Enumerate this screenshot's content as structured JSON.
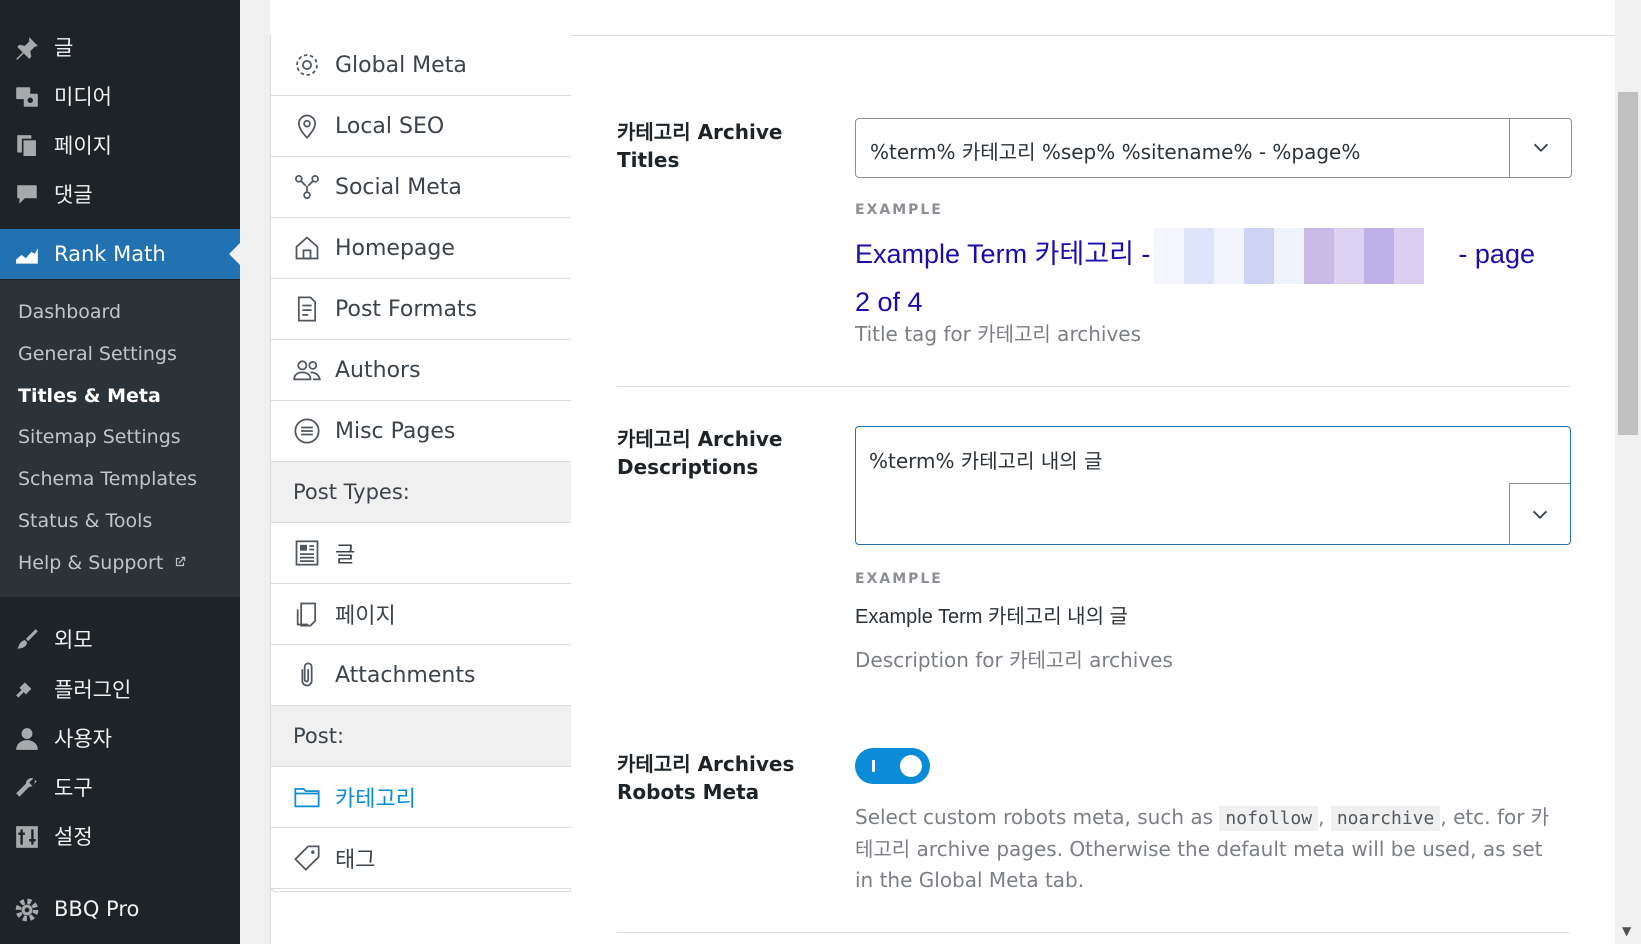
{
  "admin_menu": {
    "items_top": [
      {
        "label": "글",
        "icon": "pin-icon"
      },
      {
        "label": "미디어",
        "icon": "media-icon"
      },
      {
        "label": "페이지",
        "icon": "pages-icon"
      },
      {
        "label": "댓글",
        "icon": "comments-icon"
      }
    ],
    "current": {
      "label": "Rank Math",
      "icon": "rank-math-icon"
    },
    "submenu": [
      {
        "label": "Dashboard"
      },
      {
        "label": "General Settings"
      },
      {
        "label": "Titles & Meta"
      },
      {
        "label": "Sitemap Settings"
      },
      {
        "label": "Schema Templates"
      },
      {
        "label": "Status & Tools"
      },
      {
        "label": "Help & Support"
      }
    ],
    "items_bottom": [
      {
        "label": "외모",
        "icon": "appearance-icon"
      },
      {
        "label": "플러그인",
        "icon": "plugins-icon"
      },
      {
        "label": "사용자",
        "icon": "users-icon"
      },
      {
        "label": "도구",
        "icon": "tools-icon"
      },
      {
        "label": "설정",
        "icon": "settings-icon"
      },
      {
        "label": "BBQ Pro",
        "icon": "gear-icon"
      }
    ]
  },
  "tabs": {
    "general": [
      {
        "label": "Global Meta",
        "icon": "gear-icon"
      },
      {
        "label": "Local SEO",
        "icon": "location-pin-icon"
      },
      {
        "label": "Social Meta",
        "icon": "share-nodes-icon"
      },
      {
        "label": "Homepage",
        "icon": "home-icon"
      },
      {
        "label": "Post Formats",
        "icon": "document-icon"
      },
      {
        "label": "Authors",
        "icon": "users-icon"
      },
      {
        "label": "Misc Pages",
        "icon": "list-circle-icon"
      }
    ],
    "post_types_heading": "Post Types:",
    "post_types": [
      {
        "label": "글",
        "icon": "article-icon"
      },
      {
        "label": "페이지",
        "icon": "page-icon"
      },
      {
        "label": "Attachments",
        "icon": "paperclip-icon"
      }
    ],
    "post_heading": "Post:",
    "post": [
      {
        "label": "카테고리",
        "icon": "folder-icon"
      },
      {
        "label": "태그",
        "icon": "tag-icon"
      }
    ]
  },
  "fields": {
    "archive_titles": {
      "label": "카테고리 Archive Titles",
      "value": "%term% 카테고리 %sep% %sitename% - %page%",
      "example_label": "EXAMPLE",
      "example_prefix": "Example Term 카테고리 -",
      "example_suffix": "- page 2 of 4",
      "help": "Title tag for 카테고리 archives"
    },
    "archive_descriptions": {
      "label": "카테고리 Archive Descriptions",
      "value": "%term% 카테고리 내의 글",
      "example_label": "EXAMPLE",
      "example": "Example Term 카테고리 내의 글",
      "help": "Description for 카테고리 archives"
    },
    "robots_meta": {
      "label": "카테고리 Archives Robots Meta",
      "toggle_on": true,
      "help_before": "Select custom robots meta, such as",
      "code1": "nofollow",
      "comma": ",",
      "code2": "noarchive",
      "help_after": ", etc. for 카테고리 archive pages. Otherwise the default meta will be used, as set in the Global Meta tab."
    }
  },
  "colors": {
    "sidebar_bg": "#1d2327",
    "submenu_bg": "#2c3338",
    "accent": "#2271b1",
    "active_tab": "#0c8cd8",
    "serp_title": "#1a0dab"
  }
}
